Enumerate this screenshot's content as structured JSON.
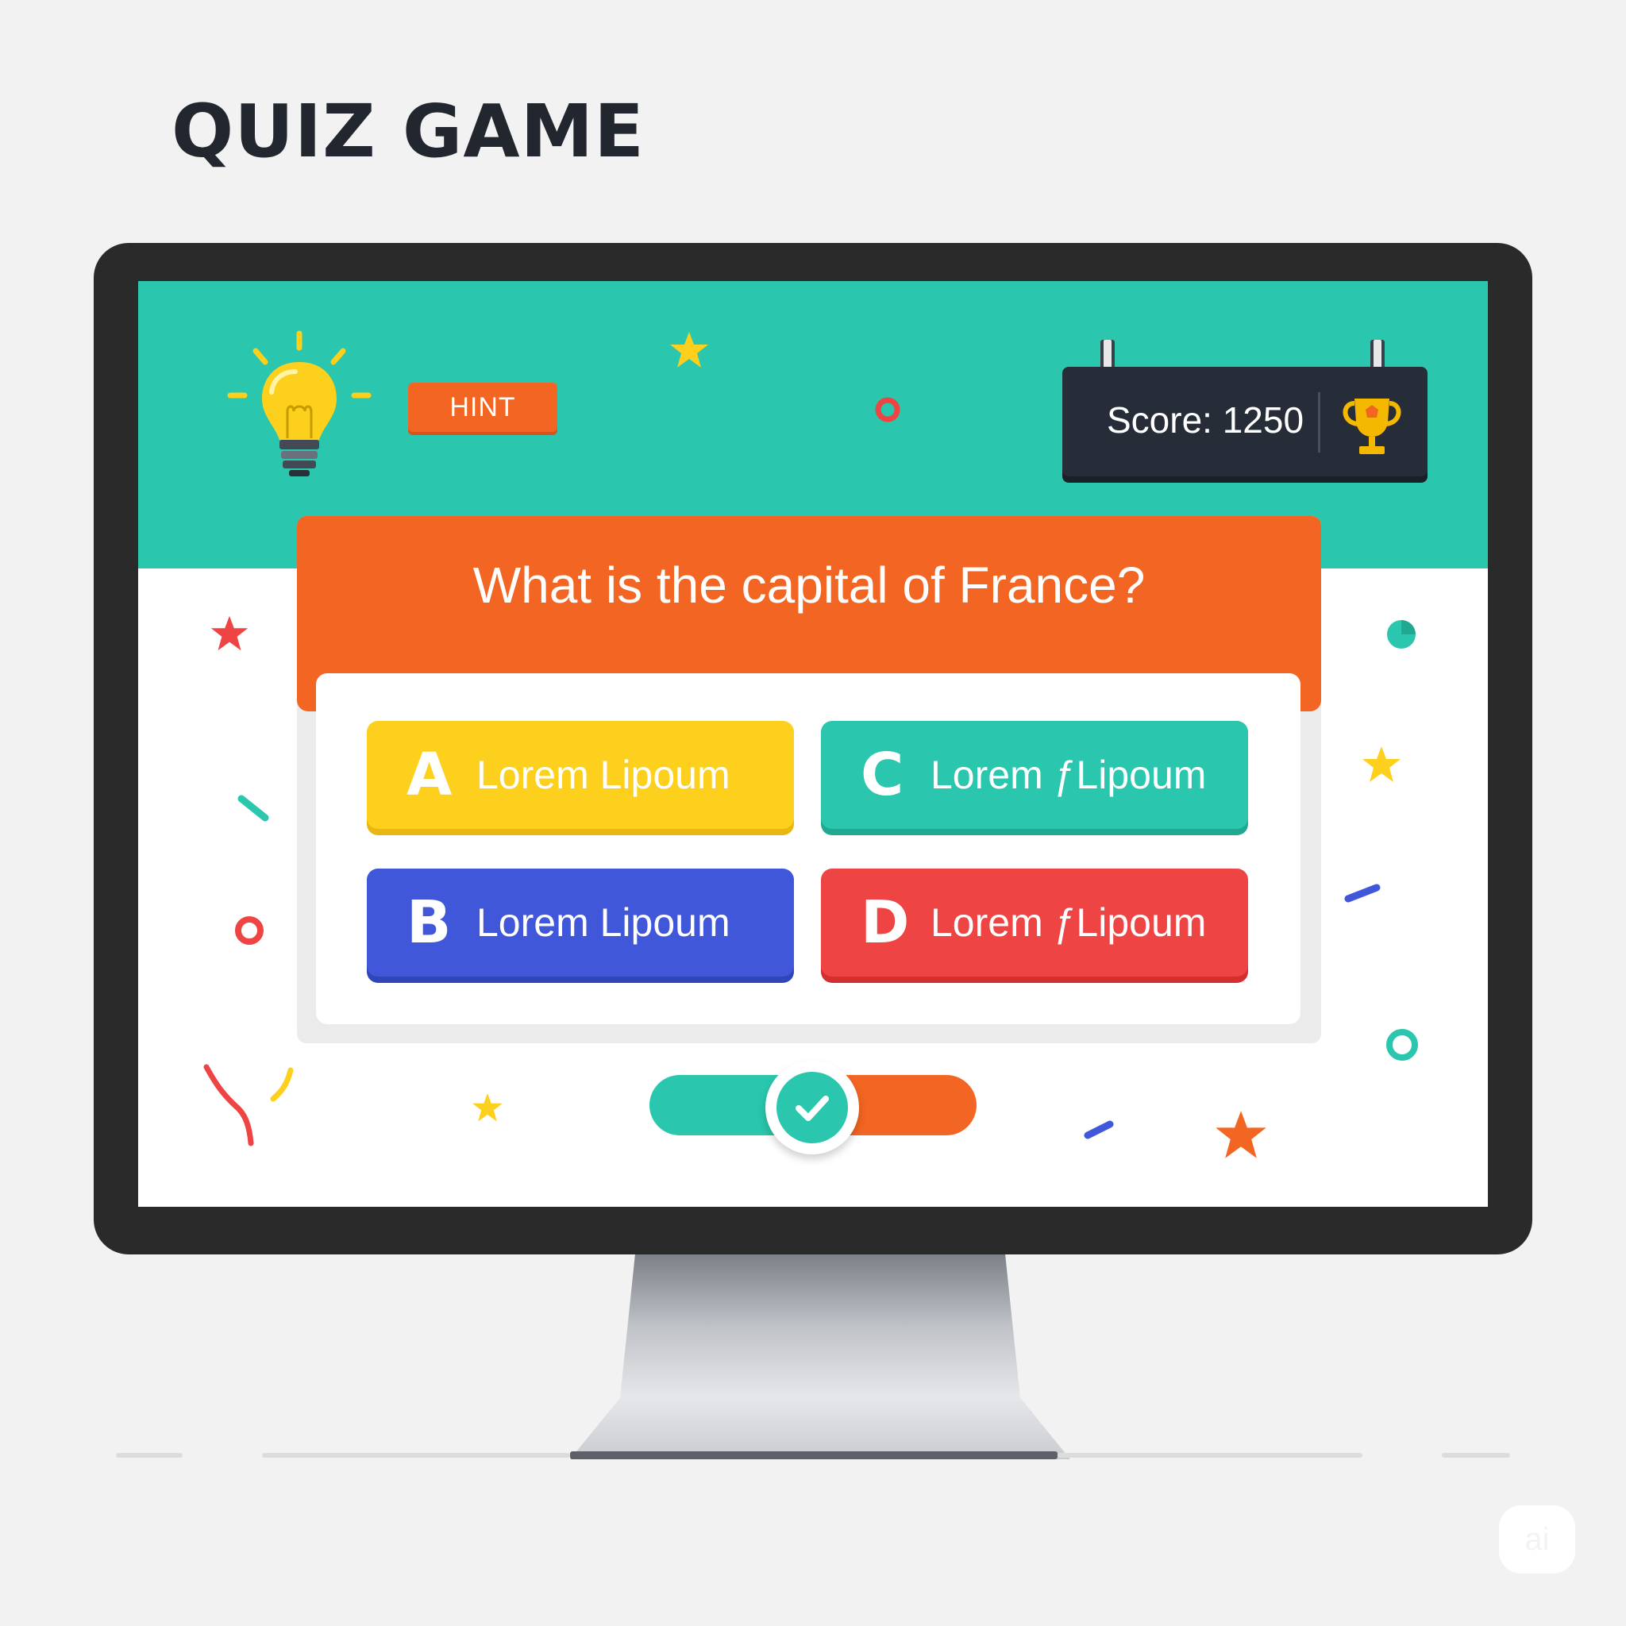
{
  "page": {
    "title": "QUIZ GAME"
  },
  "header": {
    "hint_label": "HINT",
    "score_label": "Score: 1250",
    "icons": {
      "hint": "lightbulb-icon",
      "score": "trophy-icon"
    }
  },
  "question": {
    "text": "What is the capital of France?",
    "answers": [
      {
        "letter": "A",
        "label": "Lorem Lipoum",
        "color": "#fcd01c"
      },
      {
        "letter": "C",
        "label": "Lorem ƒLipoum",
        "color": "#2ac6ad"
      },
      {
        "letter": "B",
        "label": "Lorem Lipoum",
        "color": "#3f57d8"
      },
      {
        "letter": "D",
        "label": "Lorem ƒLipoum",
        "color": "#ef4444"
      }
    ]
  },
  "controls": {
    "confirm_icon": "checkmark-icon"
  },
  "colors": {
    "teal": "#2ac6ad",
    "orange": "#f26522",
    "yellow": "#fcd01c",
    "blue": "#3f57d8",
    "red": "#ef4444",
    "dark": "#272d38"
  },
  "watermark": "ai"
}
